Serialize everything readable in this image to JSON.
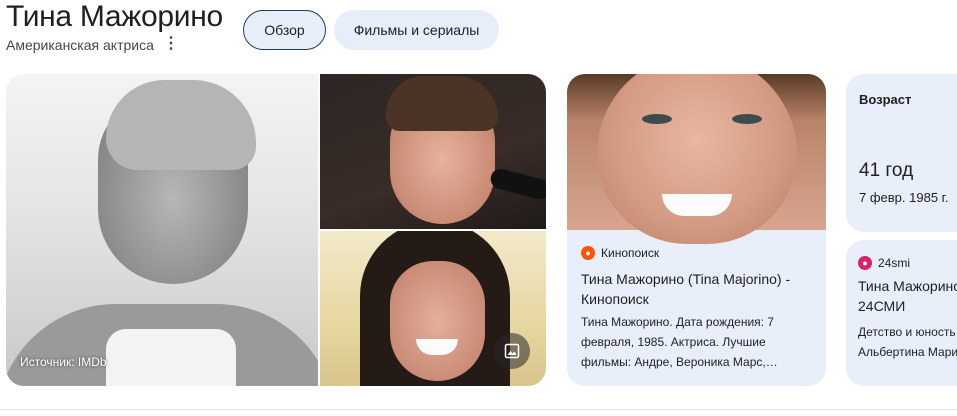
{
  "header": {
    "title": "Тина Мажорино",
    "subtitle": "Американская актриса",
    "more_icon": "more-vert-icon"
  },
  "tabs": [
    {
      "label": "Обзор",
      "selected": true
    },
    {
      "label": "Фильмы и сериалы",
      "selected": false
    }
  ],
  "gallery": {
    "source_label": "Источник: IMDb",
    "image_button_icon": "image-icon"
  },
  "cards": {
    "kinopoisk": {
      "source": "Кинопоиск",
      "title": "Тина Мажорино (Tina Majorino) - Кинопоиск",
      "snippet": "Тина Мажорино. Дата рождения: 7 февраля, 1985. Актриса. Лучшие фильмы: Андре, Вероника Марс,…",
      "favicon_color": "#ff5500"
    },
    "age": {
      "label": "Возраст",
      "value": "41 год",
      "date": "7 февр. 1985 г."
    },
    "smi24": {
      "source": "24smi",
      "title": "Тина Мажорино",
      "title_line2": "24СМИ",
      "snippet": "Детство и юность",
      "snippet_line2": "Альбертина Мари",
      "favicon_color": "#d6246e"
    }
  },
  "colors": {
    "card_bg": "#e9eefb",
    "selected_tab_border": "#1f3a63"
  }
}
